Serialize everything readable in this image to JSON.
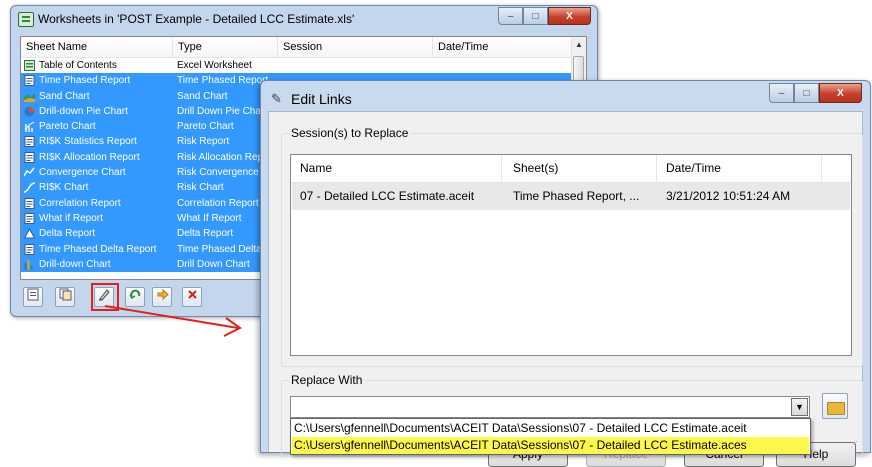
{
  "worksheets_window": {
    "title": "Worksheets in 'POST Example - Detailed LCC Estimate.xls'",
    "columns": [
      "Sheet Name",
      "Type",
      "Session",
      "Date/Time"
    ],
    "rows": [
      {
        "name": "Table of Contents",
        "type": "Excel Worksheet",
        "selected": false,
        "icon": "excel-sheet-icon"
      },
      {
        "name": "Time Phased Report",
        "type": "Time Phased Report",
        "selected": true,
        "icon": "report-icon"
      },
      {
        "name": "Sand Chart",
        "type": "Sand Chart",
        "selected": true,
        "icon": "area-chart-icon"
      },
      {
        "name": "Drill-down Pie Chart",
        "type": "Drill Down Pie Chart",
        "selected": true,
        "icon": "pie-chart-icon"
      },
      {
        "name": "Pareto Chart",
        "type": "Pareto Chart",
        "selected": true,
        "icon": "pareto-chart-icon"
      },
      {
        "name": "RI$K Statistics Report",
        "type": "Risk Report",
        "selected": true,
        "icon": "report-icon"
      },
      {
        "name": "RI$K Allocation Report",
        "type": "Risk Allocation Repor",
        "selected": true,
        "icon": "report-icon"
      },
      {
        "name": "Convergence Chart",
        "type": "Risk Convergence ...",
        "selected": true,
        "icon": "line-chart-icon"
      },
      {
        "name": "RI$K Chart",
        "type": "Risk Chart",
        "selected": true,
        "icon": "s-curve-chart-icon"
      },
      {
        "name": "Correlation Report",
        "type": "Correlation Report",
        "selected": true,
        "icon": "report-icon"
      },
      {
        "name": "What if Report",
        "type": "What If Report",
        "selected": true,
        "icon": "report-icon"
      },
      {
        "name": "Delta Report",
        "type": "Delta Report",
        "selected": true,
        "icon": "delta-icon"
      },
      {
        "name": "Time Phased Delta Report",
        "type": "Time Phased Delta ...",
        "selected": true,
        "icon": "report-icon"
      },
      {
        "name": "Drill-down Chart",
        "type": "Drill Down Chart",
        "selected": true,
        "icon": "bar-chart-icon"
      }
    ],
    "toolbar": [
      "new-sheet-icon",
      "copy-sheet-icon",
      "edit-links-icon",
      "refresh-icon",
      "goto-arrow-icon",
      "delete-icon"
    ],
    "caption_buttons": {
      "minimize": "–",
      "maximize": "□",
      "close": "X"
    },
    "scroll_up": "▲"
  },
  "edit_links_dialog": {
    "title": "Edit Links",
    "caption_buttons": {
      "minimize": "–",
      "maximize": "□",
      "close": "X"
    },
    "sessions_group": "Session(s) to Replace",
    "columns": [
      "Name",
      "Sheet(s)",
      "Date/Time"
    ],
    "row": {
      "name": "07 - Detailed LCC Estimate.aceit",
      "sheets": "Time Phased Report, ...",
      "datetime": "3/21/2012 10:51:24 AM"
    },
    "replace_group": "Replace With",
    "combo_value": "",
    "combo_arrow": "▼",
    "options": [
      "C:\\Users\\gfennell\\Documents\\ACEIT Data\\Sessions\\07 - Detailed LCC Estimate.aceit",
      "C:\\Users\\gfennell\\Documents\\ACEIT Data\\Sessions\\07 - Detailed LCC Estimate.aces"
    ],
    "buttons": {
      "apply": "Apply",
      "replace": "Replace",
      "cancel": "Cancel",
      "help": "Help"
    },
    "highlight_color": "#fbf84a"
  },
  "annotation_color": "#e0221b",
  "selection_color": "#3399ff"
}
